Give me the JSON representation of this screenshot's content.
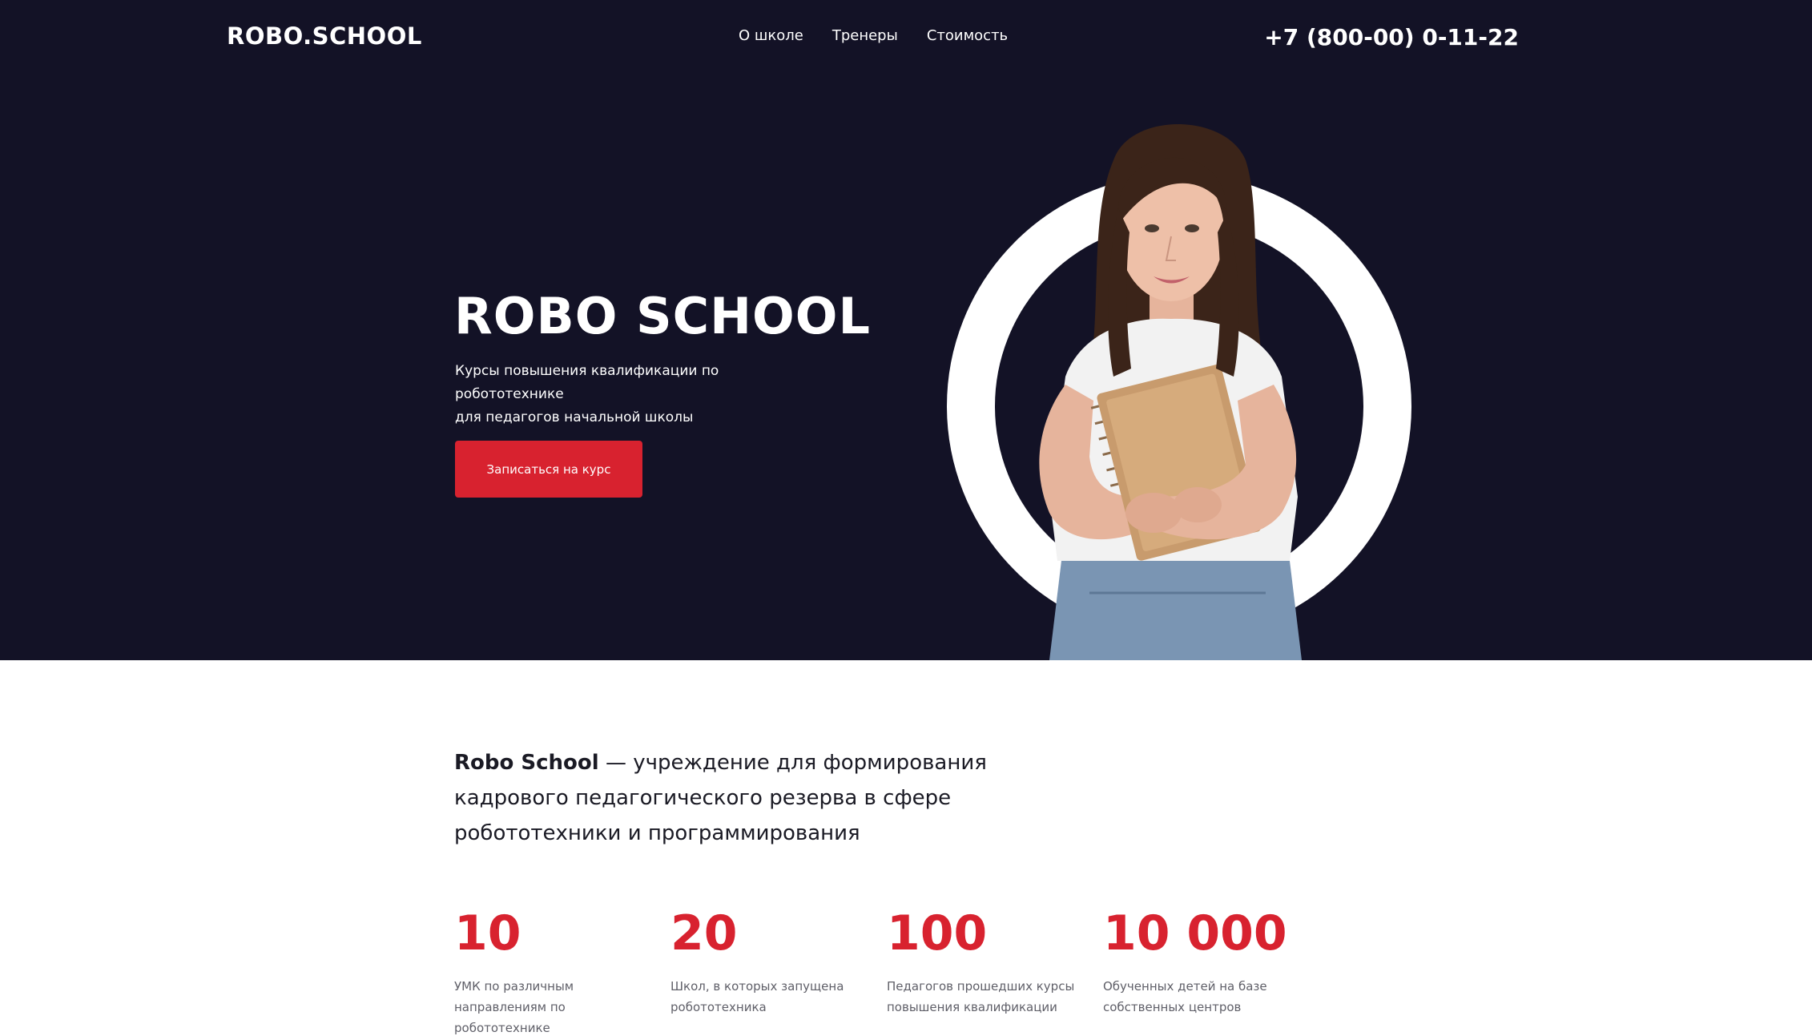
{
  "header": {
    "logo": "ROBO.SCHOOL",
    "nav": [
      "О школе",
      "Тренеры",
      "Стоимость"
    ],
    "phone": "+7 (800-00) 0-11-22"
  },
  "hero": {
    "title": "ROBO SCHOOL",
    "subtitle_line1": "Курсы повышения квалификации по робототехнике",
    "subtitle_line2": "для педагогов начальной школы",
    "cta_label": "Записаться на курс"
  },
  "about": {
    "name": "Robo School",
    "text": " — учреждение для формирования кадрового педагогического резерва в сфере робототехники и программирования"
  },
  "stats": [
    {
      "value": "10",
      "desc_line1": "УМК по различным",
      "desc_line2": "направлениям по робототехнике"
    },
    {
      "value": "20",
      "desc_line1": "Школ, в которых запущена",
      "desc_line2": "робототехника"
    },
    {
      "value": "100",
      "desc_line1": "Педагогов прошедших курсы",
      "desc_line2": "повышения квалификации"
    },
    {
      "value": "10 000",
      "desc_line1": "Обученных детей на базе",
      "desc_line2": "собственных центров"
    }
  ],
  "colors": {
    "hero_background": "#131226",
    "accent": "#d8222f",
    "text_dark": "#1a1a24",
    "text_muted": "#5f5f68"
  }
}
